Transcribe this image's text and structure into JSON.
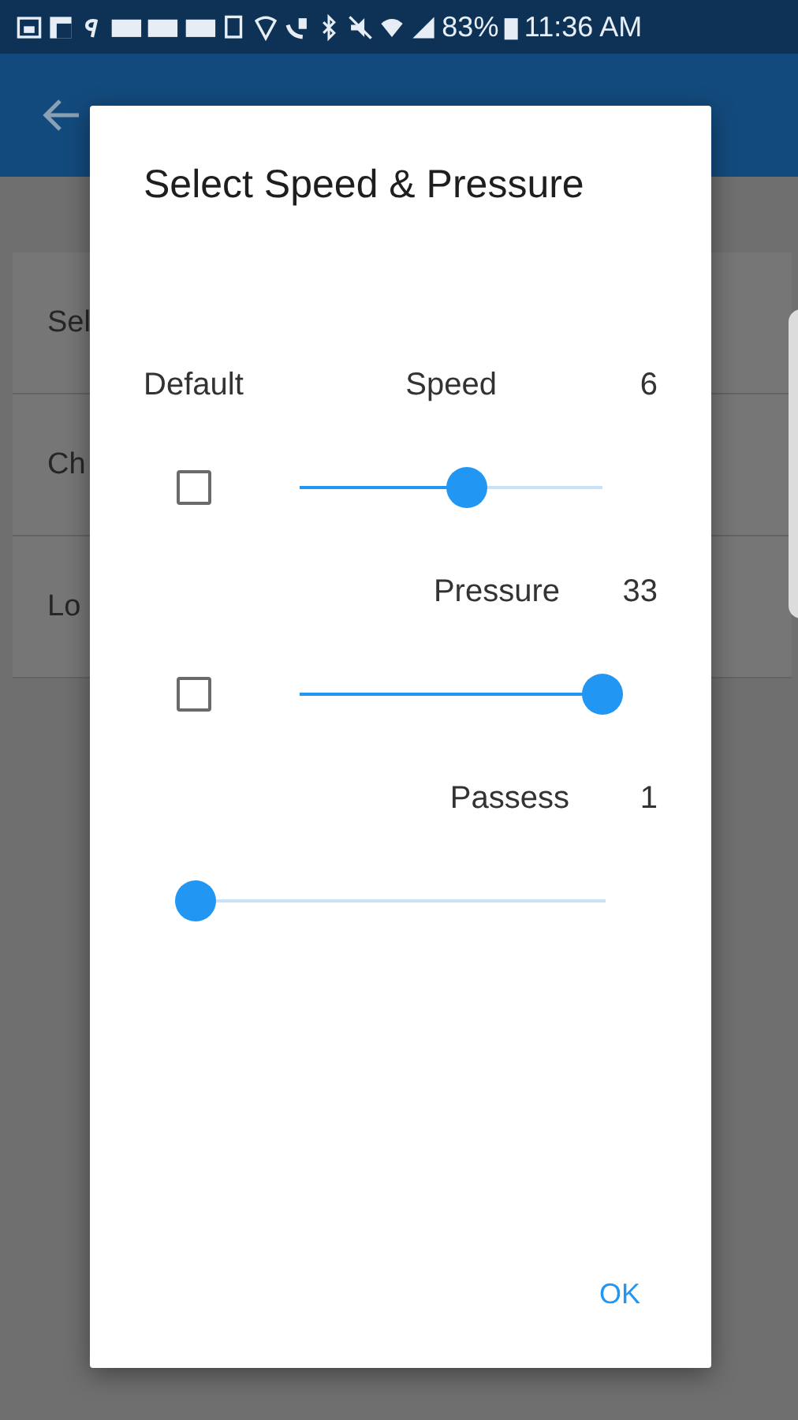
{
  "status_bar": {
    "battery": "83%",
    "time": "11:36 AM"
  },
  "background_list": [
    {
      "label": "Sel"
    },
    {
      "label": "Ch"
    },
    {
      "label": "Lo"
    }
  ],
  "dialog": {
    "title": "Select Speed & Pressure",
    "column_label": "Default",
    "controls": [
      {
        "kind": "checkbox-slider",
        "label": "Speed",
        "value": "6",
        "checked": false,
        "level": 0.55
      },
      {
        "kind": "checkbox-slider",
        "label": "Pressure",
        "value": "33",
        "checked": false,
        "level": 1
      },
      {
        "kind": "slider",
        "label": "Passess",
        "value": "1",
        "level": 0
      }
    ],
    "ok": "OK"
  }
}
